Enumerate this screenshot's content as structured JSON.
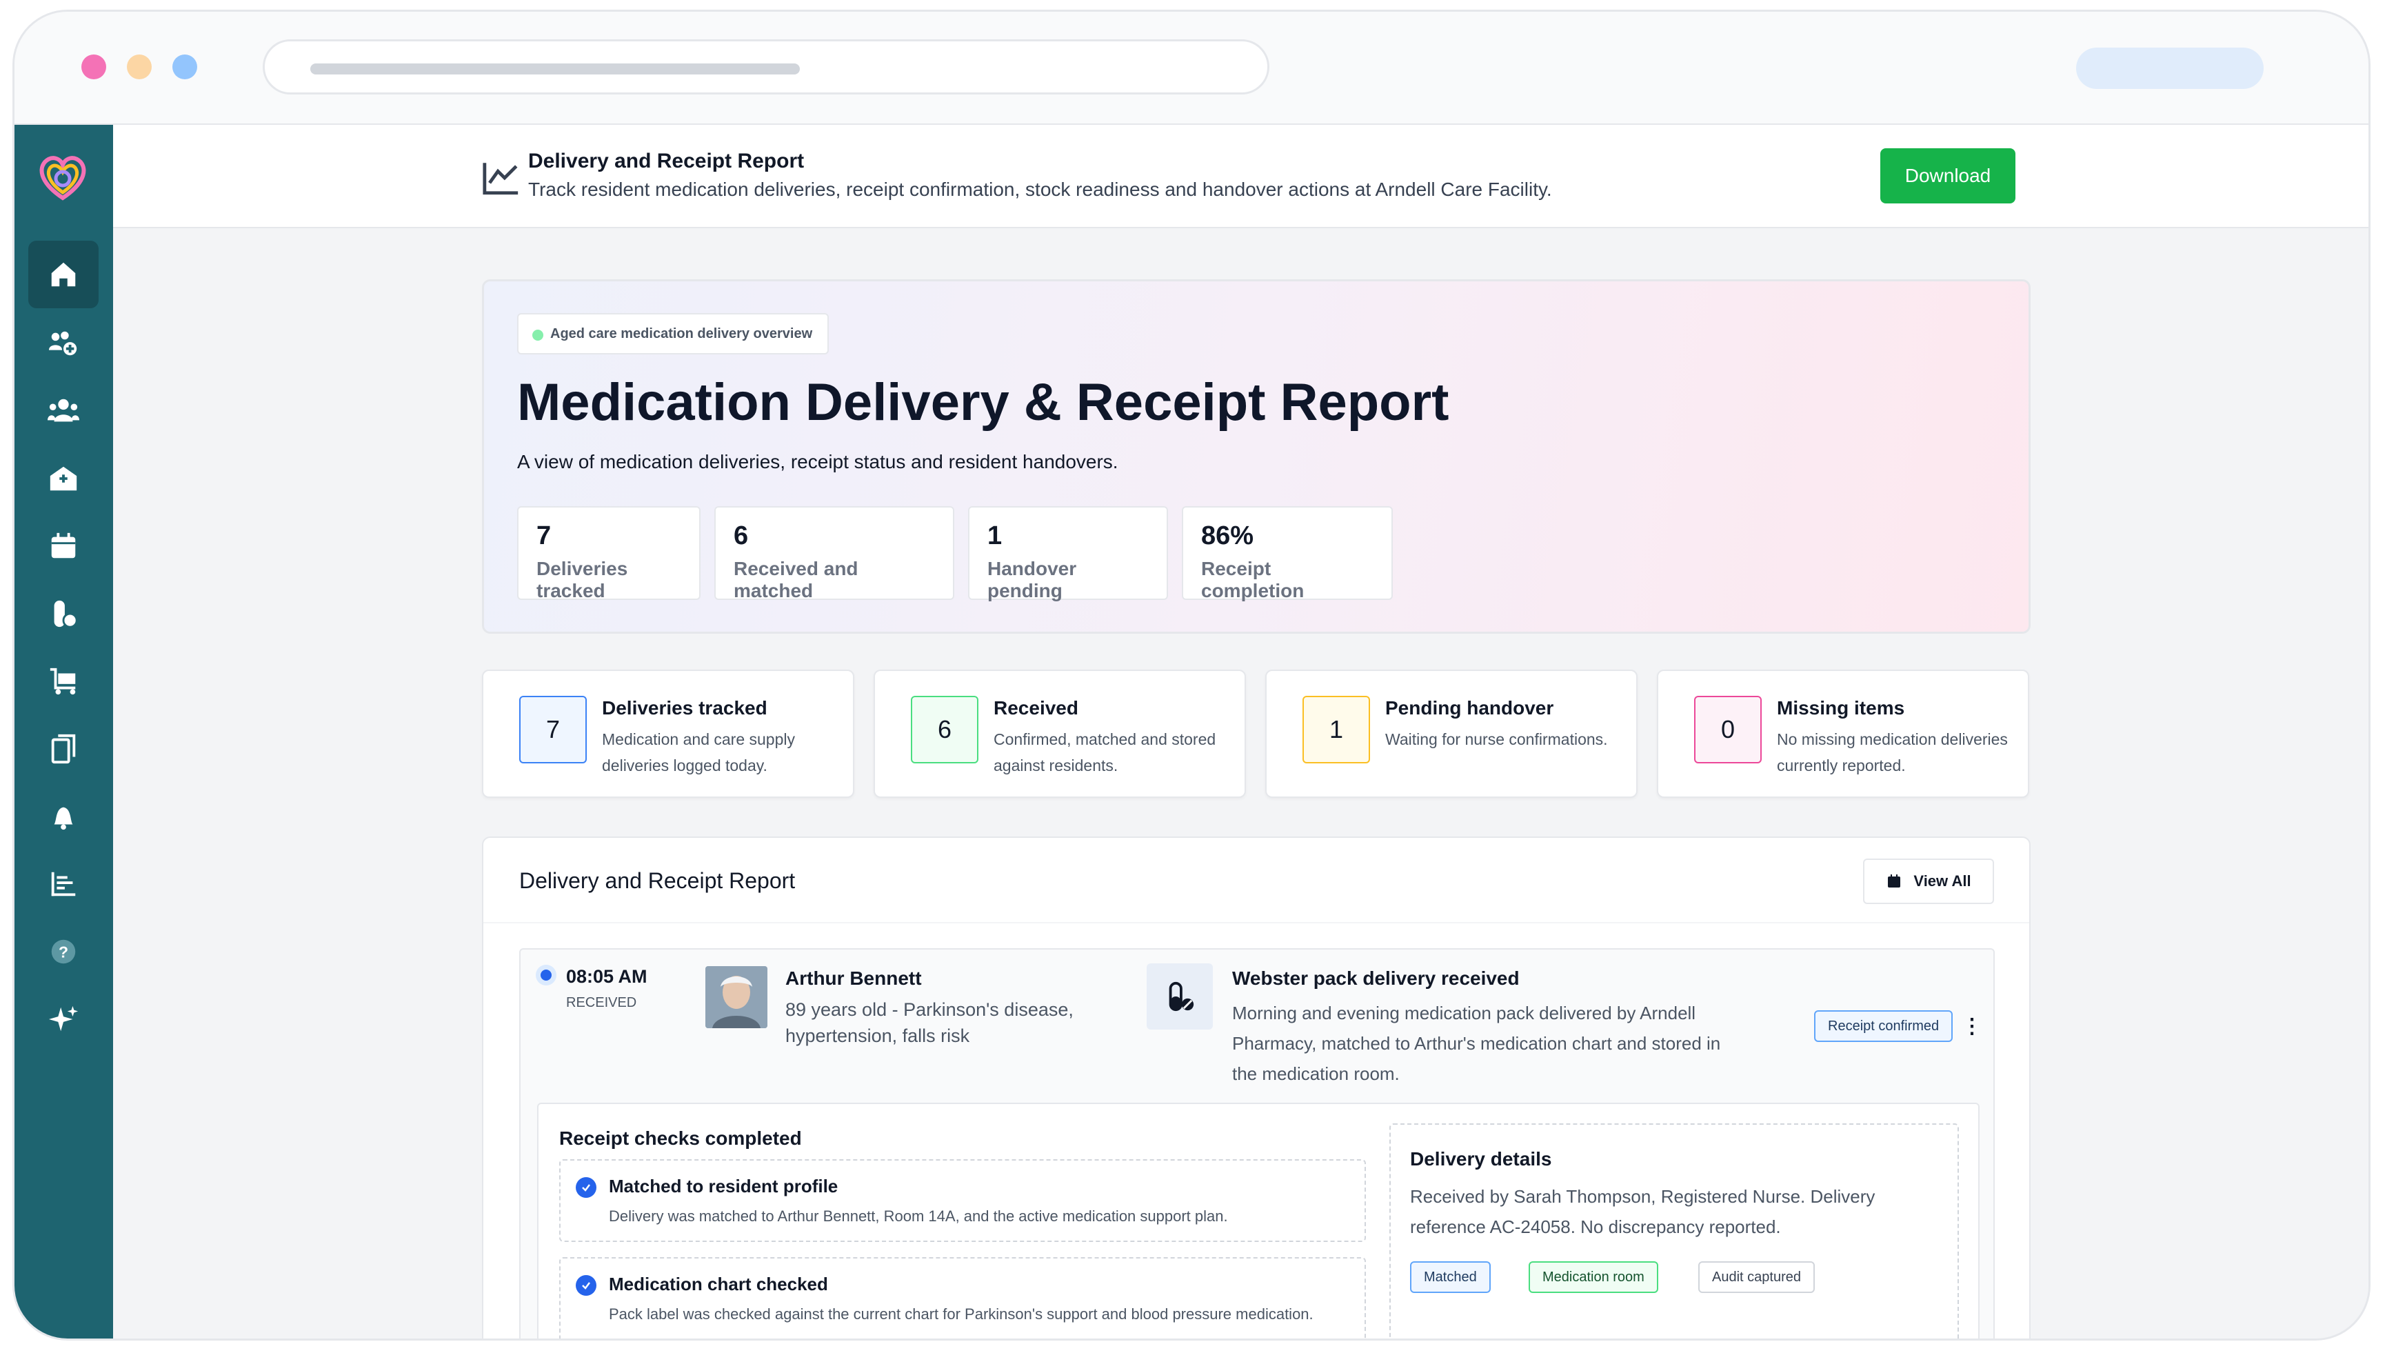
{
  "colors": {
    "sidebar": "#1e6470",
    "accent_green": "#16b34a",
    "accent_blue": "#2563eb"
  },
  "window": {
    "dots": [
      "#f472b6",
      "#fcd6a4",
      "#93c5fd"
    ]
  },
  "sidebar": {
    "items": [
      {
        "icon": "home-icon",
        "active": true
      },
      {
        "icon": "users-add-icon"
      },
      {
        "icon": "residents-icon"
      },
      {
        "icon": "facility-icon"
      },
      {
        "icon": "calendar-icon"
      },
      {
        "icon": "medication-icon"
      },
      {
        "icon": "cart-icon"
      },
      {
        "icon": "documents-icon"
      },
      {
        "icon": "bell-icon"
      },
      {
        "icon": "list-icon"
      },
      {
        "icon": "help-icon"
      },
      {
        "icon": "sparkle-icon"
      }
    ]
  },
  "header": {
    "title": "Delivery and Receipt Report",
    "subtitle": "Track resident medication deliveries, receipt confirmation, stock readiness and handover actions at Arndell Care Facility.",
    "download_label": "Download"
  },
  "hero": {
    "tag": "Aged care medication delivery overview",
    "title": "Medication Delivery & Receipt Report",
    "subtitle": "A view of medication deliveries, receipt status and resident handovers.",
    "stats": [
      {
        "value": "7",
        "label": "Deliveries tracked"
      },
      {
        "value": "6",
        "label": "Received and matched"
      },
      {
        "value": "1",
        "label": "Handover pending"
      },
      {
        "value": "86%",
        "label": "Receipt completion"
      }
    ]
  },
  "cards": [
    {
      "value": "7",
      "title": "Deliveries tracked",
      "desc": "Medication and care supply deliveries logged today."
    },
    {
      "value": "6",
      "title": "Received",
      "desc": "Confirmed, matched and stored against residents."
    },
    {
      "value": "1",
      "title": "Pending handover",
      "desc": "Waiting for nurse confirmations."
    },
    {
      "value": "0",
      "title": "Missing items",
      "desc": "No missing medication deliveries currently reported."
    }
  ],
  "report": {
    "title": "Delivery and Receipt Report",
    "view_all": "View All",
    "entry": {
      "time": "08:05 AM",
      "status": "RECEIVED",
      "name": "Arthur Bennett",
      "desc": "89 years old - Parkinson's disease, hypertension, falls risk",
      "med_title": "Webster pack delivery received",
      "med_desc": "Morning and evening medication pack delivered by Arndell Pharmacy, matched to Arthur's medication chart and stored in the medication room.",
      "badge": "Receipt confirmed",
      "checks_title": "Receipt checks completed",
      "checks": [
        {
          "title": "Matched to resident profile",
          "desc": "Delivery was matched to Arthur Bennett, Room 14A, and the active medication support plan."
        },
        {
          "title": "Medication chart checked",
          "desc": "Pack label was checked against the current chart for Parkinson's support and blood pressure medication."
        }
      ],
      "details_title": "Delivery details",
      "details_desc": "Received by Sarah Thompson, Registered Nurse. Delivery reference AC-24058. No discrepancy reported.",
      "details_tags": [
        "Matched",
        "Medication room",
        "Audit captured"
      ]
    }
  }
}
